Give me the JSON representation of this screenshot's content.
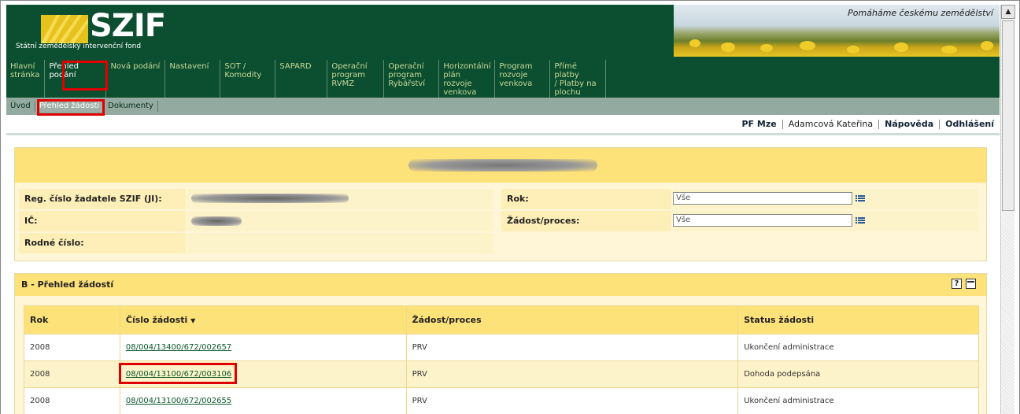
{
  "brand": {
    "logo": "SZIF",
    "subtitle": "Státní zemědělský intervenční fond",
    "slogan": "Pomáháme českému zemědělství"
  },
  "main_nav": [
    {
      "label": "Hlavní\nstránka"
    },
    {
      "label": "Přehled\npodání",
      "active": true
    },
    {
      "label": "Nová podání"
    },
    {
      "label": "Nastavení"
    },
    {
      "label": "SOT /\nKomodity"
    },
    {
      "label": "SAPARD"
    },
    {
      "label": "Operační\nprogram\nRVMZ"
    },
    {
      "label": "Operační\nprogram\nRybářství"
    },
    {
      "label": "Horizontální\nplán rozvoje\nvenkova"
    },
    {
      "label": "Program\nrozvoje\nvenkova"
    },
    {
      "label": "Přímé platby\n/ Platby na\nplochu"
    }
  ],
  "sub_nav": [
    {
      "label": "Úvod"
    },
    {
      "label": "Přehled žádostí",
      "active": true
    },
    {
      "label": "Dokumenty"
    }
  ],
  "user_bar": {
    "org": "PF Mze",
    "user": "Adamcová Kateřina",
    "help": "Nápověda",
    "logout": "Odhlášení"
  },
  "filters": {
    "reg_label": "Reg. číslo žadatele SZIF (JI):",
    "ic_label": "IČ:",
    "rodne_label": "Rodné číslo:",
    "rok_label": "Rok:",
    "rok_value": "Vše",
    "zadost_label": "Žádost/proces:",
    "zadost_value": "Vše"
  },
  "section_b": {
    "title": "B - Přehled žádostí",
    "help_button": "?",
    "columns": [
      "Rok",
      "Číslo žádosti",
      "Žádost/proces",
      "Status žádosti"
    ],
    "sort_glyph": "▼",
    "rows": [
      {
        "rok": "2008",
        "cislo": "08/004/13400/672/002657",
        "proces": "PRV",
        "status": "Ukončení administrace"
      },
      {
        "rok": "2008",
        "cislo": "08/004/13100/672/003106",
        "proces": "PRV",
        "status": "Dohoda podepsána"
      },
      {
        "rok": "2008",
        "cislo": "08/004/13100/672/002655",
        "proces": "PRV",
        "status": "Ukončení administrace"
      }
    ]
  },
  "colors": {
    "header_green": "#0c4e30",
    "panel_yellow": "#fde27a",
    "highlight_red": "#e10000"
  }
}
